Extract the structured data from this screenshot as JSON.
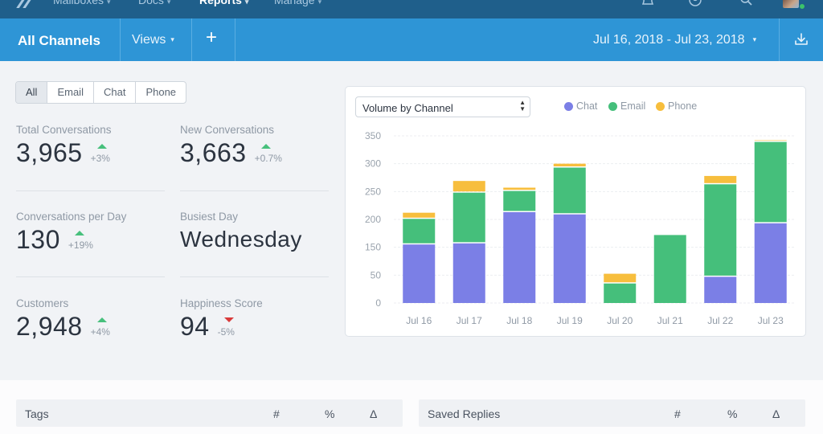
{
  "topnav": {
    "items": [
      {
        "label": "Mailboxes",
        "active": false
      },
      {
        "label": "Docs",
        "active": false
      },
      {
        "label": "Reports",
        "active": true
      },
      {
        "label": "Manage",
        "active": false
      }
    ],
    "icons": [
      "notifications-bell-icon",
      "user-circle-icon",
      "search-icon",
      "avatar"
    ]
  },
  "subheader": {
    "title": "All Channels",
    "views_label": "Views",
    "add_label": "+",
    "date_range": "Jul 16, 2018 - Jul 23, 2018"
  },
  "filters": {
    "options": [
      "All",
      "Email",
      "Chat",
      "Phone"
    ],
    "selected": "All"
  },
  "stats": [
    {
      "label": "Total Conversations",
      "value": "3,965",
      "delta": "+3%",
      "direction": "up"
    },
    {
      "label": "New Conversations",
      "value": "3,663",
      "delta": "+0.7%",
      "direction": "up"
    },
    {
      "label": "Conversations per Day",
      "value": "130",
      "delta": "+19%",
      "direction": "up"
    },
    {
      "label": "Busiest Day",
      "value": "Wednesday",
      "delta": null,
      "direction": null
    },
    {
      "label": "Customers",
      "value": "2,948",
      "delta": "+4%",
      "direction": "up"
    },
    {
      "label": "Happiness Score",
      "value": "94",
      "delta": "-5%",
      "direction": "down"
    }
  ],
  "chart_panel": {
    "select_value": "Volume by Channel",
    "legend": [
      {
        "label": "Chat",
        "color": "#7b7fe6"
      },
      {
        "label": "Email",
        "color": "#45bf7b"
      },
      {
        "label": "Phone",
        "color": "#f7be3d"
      }
    ]
  },
  "chart_data": {
    "type": "bar",
    "stacked": true,
    "title": "Volume by Channel",
    "xlabel": "",
    "ylabel": "",
    "categories": [
      "Jul 16",
      "Jul 17",
      "Jul 18",
      "Jul 19",
      "Jul 20",
      "Jul 21",
      "Jul 22",
      "Jul 23"
    ],
    "y_tick_labels": [
      "0",
      "50",
      "150",
      "200",
      "250",
      "300",
      "350"
    ],
    "ylim": [
      0,
      350
    ],
    "grid": true,
    "legend_position": "top",
    "series": [
      {
        "name": "Chat",
        "color": "#7b7fe6",
        "values": [
          155,
          157,
          213,
          209,
          0,
          0,
          47,
          193
        ]
      },
      {
        "name": "Email",
        "color": "#45bf7b",
        "values": [
          46,
          91,
          38,
          84,
          35,
          172,
          216,
          146
        ]
      },
      {
        "name": "Phone",
        "color": "#f7be3d",
        "values": [
          11,
          21,
          6,
          7,
          20,
          0,
          15,
          3
        ]
      }
    ]
  },
  "tables": [
    {
      "title": "Tags",
      "columns": [
        "#",
        "%",
        "Δ"
      ]
    },
    {
      "title": "Saved Replies",
      "columns": [
        "#",
        "%",
        "Δ"
      ]
    }
  ]
}
